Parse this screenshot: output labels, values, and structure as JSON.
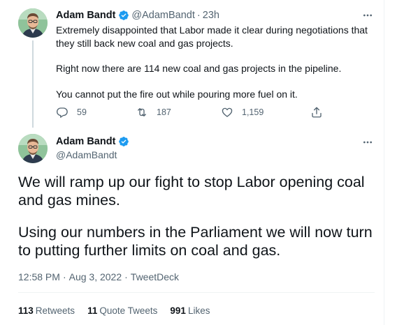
{
  "parent_tweet": {
    "author_name": "Adam Bandt",
    "author_handle": "@AdamBandt",
    "separator": "·",
    "time": "23h",
    "paragraphs": [
      "Extremely disappointed that Labor made it clear during negotiations that they still back new coal and gas projects.",
      "Right now there are 114 new coal and gas projects in the pipeline.",
      "You cannot put the fire out while pouring more fuel on it."
    ],
    "replies": "59",
    "retweets": "187",
    "likes": "1,159"
  },
  "main_tweet": {
    "author_name": "Adam Bandt",
    "author_handle": "@AdamBandt",
    "paragraphs": [
      "We will ramp up our fight to stop Labor opening coal and gas mines.",
      "Using our numbers in the Parliament we will now turn to putting further limits on coal and gas."
    ],
    "time": "12:58 PM",
    "date": "Aug 3, 2022",
    "source": "TweetDeck",
    "separator": "·",
    "stats": {
      "retweets_count": "113",
      "retweets_label": "Retweets",
      "quotes_count": "11",
      "quotes_label": "Quote Tweets",
      "likes_count": "991",
      "likes_label": "Likes"
    }
  },
  "icons": {
    "verified": "verified-badge-icon",
    "more": "more-options-icon",
    "reply": "reply-icon",
    "retweet": "retweet-icon",
    "like": "heart-icon",
    "share": "share-icon"
  },
  "colors": {
    "text_primary": "#0f1419",
    "text_secondary": "#536471",
    "verified_blue": "#1d9bf0",
    "thread_line": "#cfd9de",
    "divider": "#eff3f4"
  }
}
